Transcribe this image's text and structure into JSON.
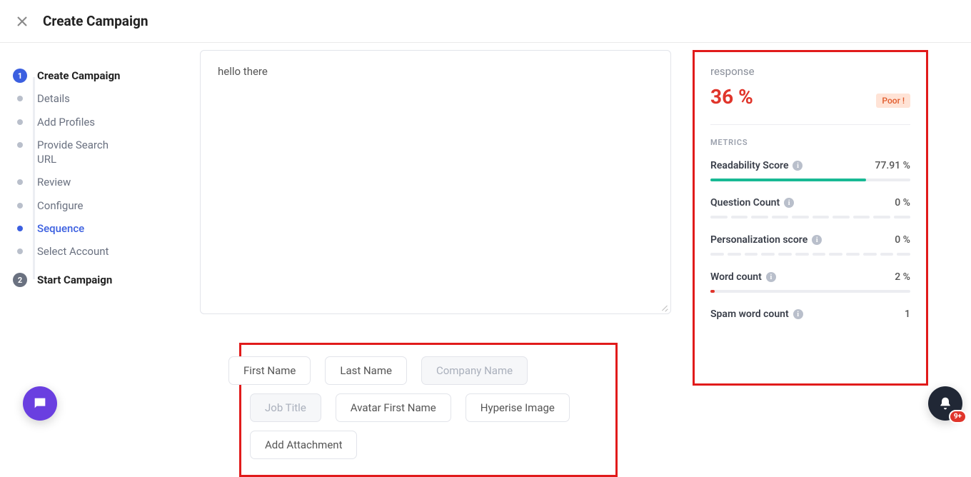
{
  "header": {
    "title": "Create Campaign"
  },
  "sidebar": {
    "step1": {
      "num": "1",
      "label": "Create Campaign"
    },
    "subs": [
      {
        "label": "Details",
        "active": false
      },
      {
        "label": "Add Profiles",
        "active": false
      },
      {
        "label": "Provide Search URL",
        "active": false
      },
      {
        "label": "Review",
        "active": false
      },
      {
        "label": "Configure",
        "active": false
      },
      {
        "label": "Sequence",
        "active": true
      },
      {
        "label": "Select Account",
        "active": false
      }
    ],
    "step2": {
      "num": "2",
      "label": "Start Campaign"
    }
  },
  "editor": {
    "content": "hello there"
  },
  "chips": [
    {
      "label": "First Name",
      "disabled": false
    },
    {
      "label": "Last Name",
      "disabled": false
    },
    {
      "label": "Company Name",
      "disabled": true
    },
    {
      "label": "Job Title",
      "disabled": true
    },
    {
      "label": "Avatar First Name",
      "disabled": false
    },
    {
      "label": "Hyperise Image",
      "disabled": false
    },
    {
      "label": "Add Attachment",
      "disabled": false
    }
  ],
  "panel": {
    "response_label": "response",
    "response_value": "36 %",
    "response_badge": "Poor !",
    "metrics_head": "METRICS",
    "metrics": [
      {
        "name": "Readability Score",
        "value": "77.91 %",
        "type": "bar",
        "fill": 77.91
      },
      {
        "name": "Question Count",
        "value": "0 %",
        "type": "seg",
        "on": 0,
        "total": 10
      },
      {
        "name": "Personalization score",
        "value": "0 %",
        "type": "seg",
        "on": 0,
        "total": 12
      },
      {
        "name": "Word count",
        "value": "2 %",
        "type": "seg",
        "on": 1,
        "total": 1,
        "thin": true
      },
      {
        "name": "Spam word count",
        "value": "1",
        "type": "none"
      }
    ]
  },
  "fab": {
    "badge": "9+"
  }
}
